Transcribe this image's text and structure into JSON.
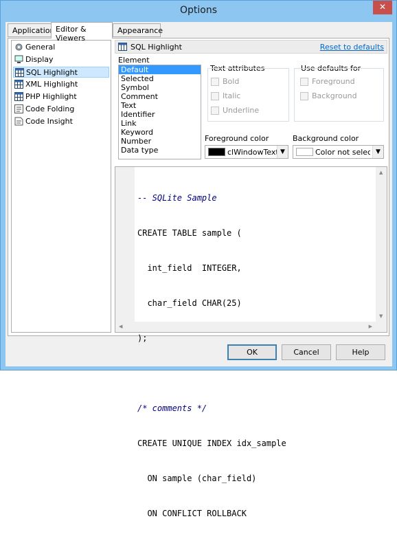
{
  "window": {
    "title": "Options",
    "close_glyph": "✕"
  },
  "tabs": [
    {
      "label": "Application",
      "active": false
    },
    {
      "label": "Editor & Viewers",
      "active": true
    },
    {
      "label": "Appearance",
      "active": false
    }
  ],
  "tree": {
    "items": [
      {
        "label": "General",
        "icon": "gear-icon"
      },
      {
        "label": "Display",
        "icon": "display-icon"
      },
      {
        "label": "SQL Highlight",
        "icon": "grid-icon",
        "selected": true
      },
      {
        "label": "XML Highlight",
        "icon": "grid-icon"
      },
      {
        "label": "PHP Highlight",
        "icon": "grid-icon"
      },
      {
        "label": "Code Folding",
        "icon": "folding-icon"
      },
      {
        "label": "Code Insight",
        "icon": "insight-icon"
      }
    ]
  },
  "panel": {
    "title": "SQL Highlight",
    "reset_link": "Reset to defaults",
    "element_label": "Element",
    "elements": [
      "Default",
      "Selected",
      "Symbol",
      "Comment",
      "Text",
      "Identifier",
      "Link",
      "Keyword",
      "Number",
      "Data type"
    ],
    "text_attributes": {
      "label": "Text attributes",
      "bold": "Bold",
      "italic": "Italic",
      "underline": "Underline"
    },
    "use_defaults": {
      "label": "Use defaults for",
      "foreground": "Foreground",
      "background": "Background"
    },
    "foreground": {
      "label": "Foreground color",
      "value": "clWindowText",
      "swatch": "#000000"
    },
    "background": {
      "label": "Background color",
      "value": "Color not selected",
      "swatch": "#ffffff"
    }
  },
  "editor": {
    "lines": [
      {
        "text": "-- SQLite Sample",
        "comment": true
      },
      {
        "text": "CREATE TABLE sample (",
        "comment": false
      },
      {
        "text": "  int_field  INTEGER,",
        "comment": false
      },
      {
        "text": "  char_field CHAR(25)",
        "comment": false
      },
      {
        "text": ");",
        "comment": false
      },
      {
        "text": "",
        "comment": false
      },
      {
        "text": "/* comments */",
        "comment": true
      },
      {
        "text": "CREATE UNIQUE INDEX idx_sample",
        "comment": false
      },
      {
        "text": "  ON sample (char_field)",
        "comment": false
      },
      {
        "text": "  ON CONFLICT ROLLBACK",
        "comment": false
      }
    ]
  },
  "buttons": {
    "ok": "OK",
    "cancel": "Cancel",
    "help": "Help"
  },
  "colors": {
    "accent": "#3399ff",
    "link": "#0066cc",
    "comment": "#000080"
  }
}
